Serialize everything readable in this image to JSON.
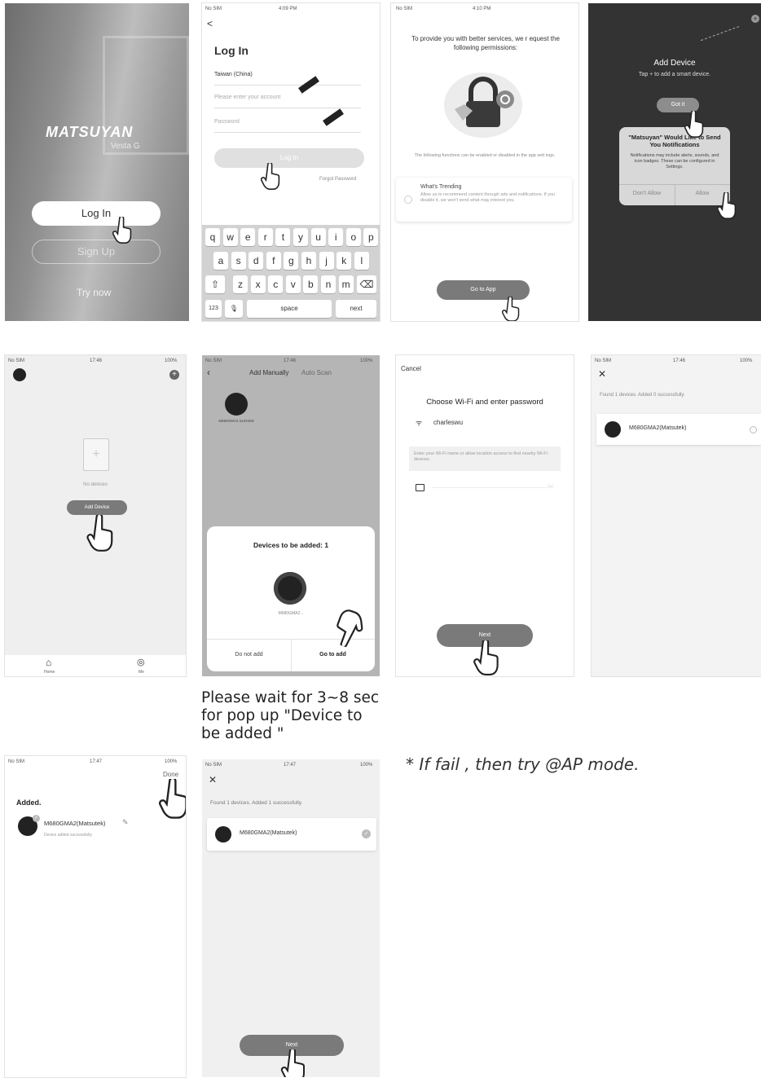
{
  "screen1": {
    "brand": "MATSUYAN",
    "model": "Vesta G",
    "login": "Log In",
    "signup": "Sign Up",
    "try": "Try now"
  },
  "screen2": {
    "status_left": "No SIM",
    "status_time": "4:09 PM",
    "back": "<",
    "title": "Log In",
    "region": "Taiwan (China)",
    "account_placeholder": "Please enter your account",
    "password_placeholder": "Password",
    "login_btn": "Log In",
    "forgot": "Forgot Password",
    "keys_row1": [
      "q",
      "w",
      "e",
      "r",
      "t",
      "y",
      "u",
      "i",
      "o",
      "p"
    ],
    "keys_row2": [
      "a",
      "s",
      "d",
      "f",
      "g",
      "h",
      "j",
      "k",
      "l"
    ],
    "keys_row3": [
      "z",
      "x",
      "c",
      "v",
      "b",
      "n",
      "m"
    ],
    "key_shift": "⇧",
    "key_delete": "⌫",
    "key_123": "123",
    "key_mic": "🎙",
    "key_space": "space",
    "key_next": "next"
  },
  "screen3": {
    "status_left": "No SIM",
    "status_time": "4:10 PM",
    "heading": "To provide you with better services, we r equest the following permissions:",
    "info": "The following functions can be enabled or disabled in the app sett ings.",
    "option_title": "What's Trending",
    "option_desc": "Allow us to recommend content through ads and notifications. If you disable it, we won't send what may interest you.",
    "go_btn": "Go to App"
  },
  "screen4": {
    "title": "Add Device",
    "subtitle": "Tap + to add a smart device.",
    "got_it": "Got it",
    "dialog_title": "\"Matsuyan\" Would Like to Send You Notifications",
    "dialog_body": "Notifications may include alerts, sounds, and icon badges. These can be configured in Settings.",
    "dont_allow": "Don't Allow",
    "allow": "Allow"
  },
  "screen5": {
    "status_left": "No SIM",
    "status_time": "17:46",
    "status_right": "100%",
    "no_devices": "No devices",
    "add_btn": "Add Device",
    "tab_home": "Home",
    "tab_me": "Me"
  },
  "screen6": {
    "status_left": "No SIM",
    "status_time": "17:46",
    "status_right": "100%",
    "tab_manual": "Add Manually",
    "tab_auto": "Auto Scan",
    "device_label": "M680GMA2 SL8H4W",
    "sheet_title": "Devices to be added: 1",
    "sheet_device": "M680GMA2...",
    "do_not_add": "Do not add",
    "go_to_add": "Go to add"
  },
  "screen7": {
    "cancel": "Cancel",
    "title": "Choose Wi-Fi and enter password",
    "wifi_name": "charleswu",
    "hint": "Enter your Wi-Fi name or allow location access to find nearby Wi-Fi devices.",
    "next": "Next"
  },
  "screen8": {
    "status_left": "No SIM",
    "status_time": "17:46",
    "status_right": "100%",
    "found": "Found 1 devices. Added 0 successfully.",
    "device": "M680GMA2(Matsutek)"
  },
  "screen9": {
    "status_left": "No SIM",
    "status_time": "17:47",
    "status_right": "100%",
    "done": "Done",
    "added": "Added.",
    "device": "M680GMA2(Matsutek)",
    "device_sub": "Device added successfully"
  },
  "screen10": {
    "status_left": "No SIM",
    "status_time": "17:47",
    "status_right": "100%",
    "found": "Found 1 devices. Added 1 successfully.",
    "device": "M680GMA2(Matsutek)",
    "next": "Next"
  },
  "caption_wait": [
    "Please wait for 3~8 sec",
    "for  pop up \"Device to",
    "be added \""
  ],
  "caption_fail": "*  If fail , then try  @AP mode.",
  "colors": {
    "dark_panel": "#333333",
    "gray_button": "#8a8a8a",
    "screen_bg": "#efefef"
  }
}
